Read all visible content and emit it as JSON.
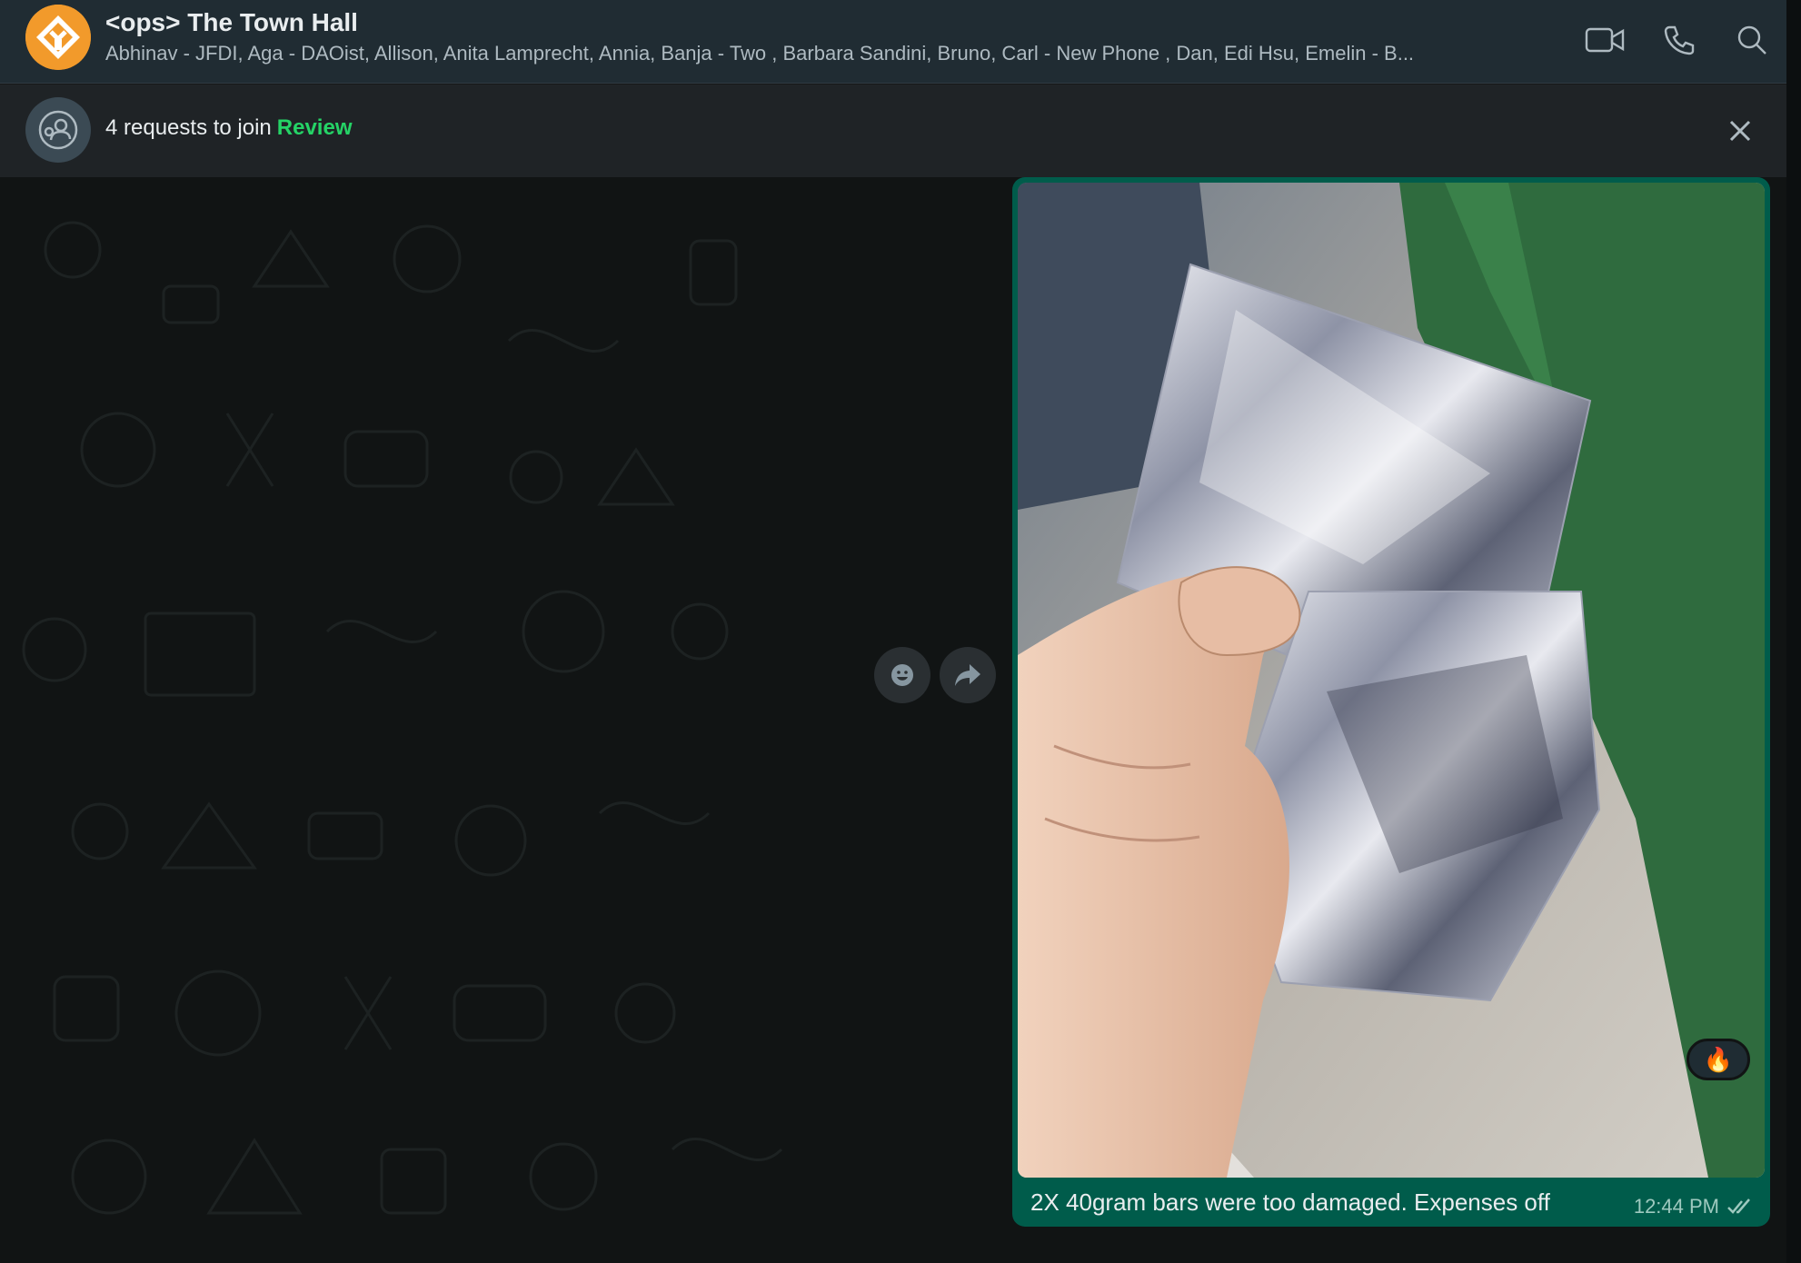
{
  "header": {
    "group_title": "<ops> The Town Hall",
    "members": "Abhinav - JFDI, Aga - DAOist, Allison, Anita Lamprecht, Annia, Banja - Two , Barbara Sandini, Bruno, Carl - New Phone , Dan, Edi Hsu, Emelin - B...",
    "avatar_icon": "group-logo-icon",
    "actions": [
      {
        "icon": "video-call-icon"
      },
      {
        "icon": "voice-call-icon"
      },
      {
        "icon": "search-icon"
      }
    ]
  },
  "requests": {
    "text": "4 requests to join",
    "review_label": "Review",
    "icon": "community-icon"
  },
  "message": {
    "caption": "2X 40gram bars were too damaged. Expenses off",
    "time": "12:44 PM",
    "status_icon": "double-check-icon",
    "reaction": "🔥",
    "photo_subject": "photo-icon"
  },
  "hover_actions": [
    {
      "icon": "emoji-reaction-icon"
    },
    {
      "icon": "forward-icon"
    }
  ],
  "colors": {
    "header_bg": "#202c33",
    "outgoing_bubble": "#005c4b",
    "accent_green": "#25d366",
    "chat_bg": "#111414",
    "avatar_orange": "#f29a2b"
  }
}
